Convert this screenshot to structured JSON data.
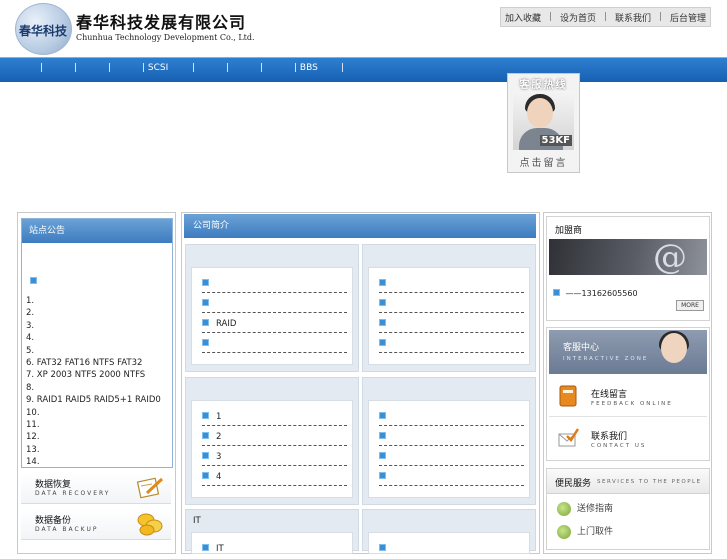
{
  "header": {
    "logo_text": "春华科技",
    "company_cn": "春华科技发展有限公司",
    "company_en": "Chunhua Technology Development Co., Ltd."
  },
  "toplinks": [
    "加入收藏",
    "设为首页",
    "联系我们",
    "后台管理"
  ],
  "nav": {
    "items": [
      "|",
      "|",
      "|",
      "| SCSI",
      "|",
      "|",
      "|",
      "| BBS",
      "|"
    ]
  },
  "service_widget": {
    "title": "客服热线",
    "photo_tag": "53KF",
    "cta": "点击留言"
  },
  "notice": {
    "title": "站点公告",
    "items": [
      "1.",
      "2.",
      "3.",
      "4.",
      "5.",
      "6. FAT32 FAT16      NTFS FAT32",
      "7. XP 2003 NTFS      2000 NTFS",
      "8.",
      "9. RAID1 RAID5 RAID5+1 RAID0",
      "10.",
      "11.",
      "12.",
      "13.",
      "14."
    ]
  },
  "left_services": [
    {
      "title": "数据恢复",
      "subtitle": "DATA RECOVERY"
    },
    {
      "title": "数据备份",
      "subtitle": "DATA BACKUP"
    }
  ],
  "intro": {
    "title": "公司简介",
    "box1_rows": [
      "",
      "",
      "RAID",
      ""
    ],
    "box2_rows": [
      "",
      "",
      "",
      ""
    ],
    "box3_rows": [
      "1",
      "2",
      "3",
      "4"
    ],
    "box4_rows": [
      "",
      "",
      "",
      ""
    ],
    "box5_label": "IT",
    "box5_rows": [
      "IT"
    ]
  },
  "join": {
    "title": "加盟商",
    "phone": "——13162605560",
    "more": "MORE"
  },
  "support": {
    "title": "客服中心",
    "subtitle": "INTERACTIVE ZONE",
    "items": [
      {
        "title": "在线留言",
        "subtitle": "FEEDBACK ONLINE"
      },
      {
        "title": "联系我们",
        "subtitle": "CONTACT US"
      }
    ]
  },
  "people": {
    "title": "便民服务",
    "subtitle": "SERVICES TO THE PEOPLE",
    "items": [
      "送修指南",
      "上门取件"
    ]
  }
}
